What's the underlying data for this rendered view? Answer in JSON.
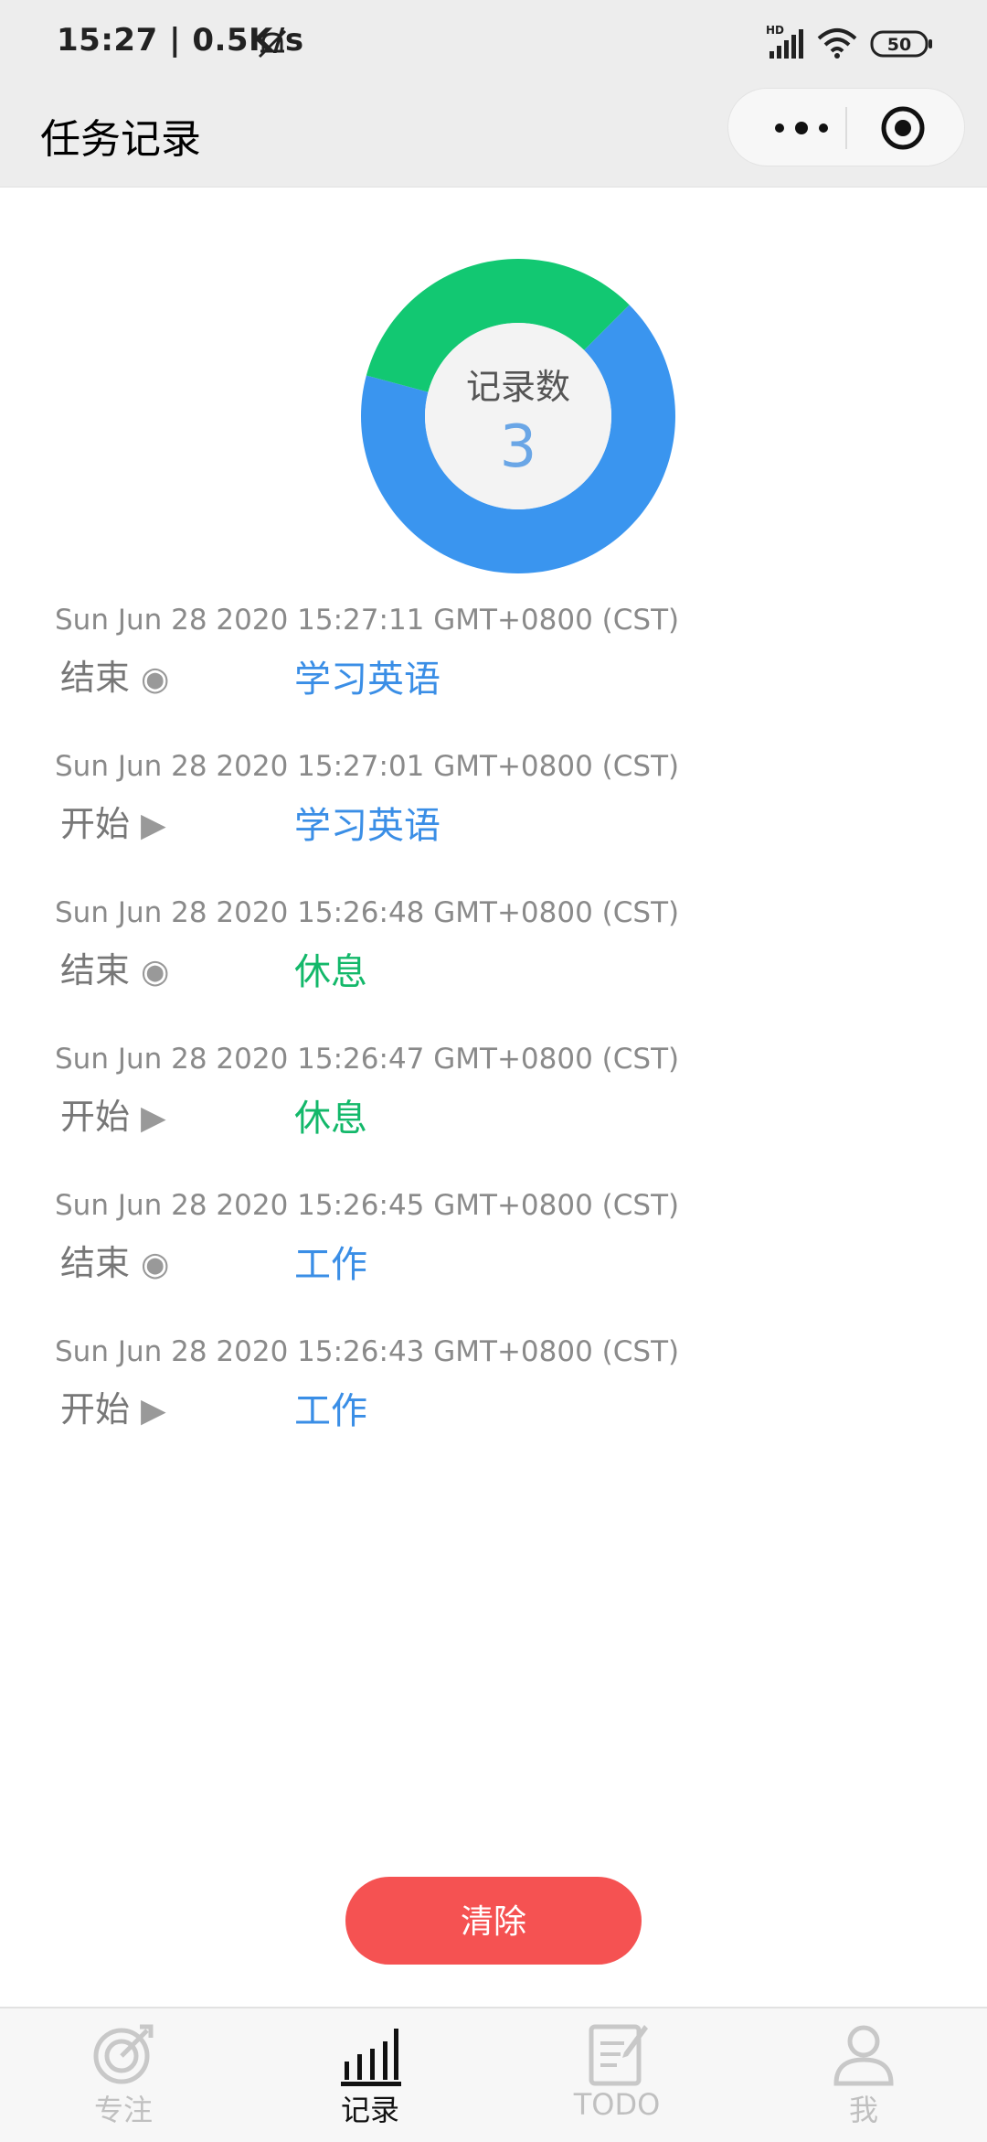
{
  "status_bar": {
    "time_net": "15:27 | 0.5K/s",
    "battery": "50"
  },
  "nav": {
    "title": "任务记录"
  },
  "chart_data": {
    "type": "pie",
    "title": "",
    "center_label": "记录数",
    "center_value": "3",
    "slices": [
      {
        "name": "学习英语",
        "value": 2,
        "color": "#3a95ef"
      },
      {
        "name": "休息",
        "value": 1,
        "color": "#12c872"
      }
    ]
  },
  "records": [
    {
      "time": "Sun Jun 28 2020 15:27:11 GMT+0800 (CST)",
      "action": "结束",
      "glyph": "◉",
      "task": "学习英语",
      "color": "#3a8ee6"
    },
    {
      "time": "Sun Jun 28 2020 15:27:01 GMT+0800 (CST)",
      "action": "开始",
      "glyph": "▶",
      "task": "学习英语",
      "color": "#3a8ee6"
    },
    {
      "time": "Sun Jun 28 2020 15:26:48 GMT+0800 (CST)",
      "action": "结束",
      "glyph": "◉",
      "task": "休息",
      "color": "#13b86a"
    },
    {
      "time": "Sun Jun 28 2020 15:26:47 GMT+0800 (CST)",
      "action": "开始",
      "glyph": "▶",
      "task": "休息",
      "color": "#13b86a"
    },
    {
      "time": "Sun Jun 28 2020 15:26:45 GMT+0800 (CST)",
      "action": "结束",
      "glyph": "◉",
      "task": "工作",
      "color": "#3a8ee6"
    },
    {
      "time": "Sun Jun 28 2020 15:26:43 GMT+0800 (CST)",
      "action": "开始",
      "glyph": "▶",
      "task": "工作",
      "color": "#3a8ee6"
    }
  ],
  "clear_label": "清除",
  "tabs": [
    {
      "label": "专注",
      "icon": "focus-target-icon",
      "active": false
    },
    {
      "label": "记录",
      "icon": "bar-chart-icon",
      "active": true
    },
    {
      "label": "TODO",
      "icon": "todo-notepad-icon",
      "active": false
    },
    {
      "label": "我",
      "icon": "person-icon",
      "active": false
    }
  ]
}
